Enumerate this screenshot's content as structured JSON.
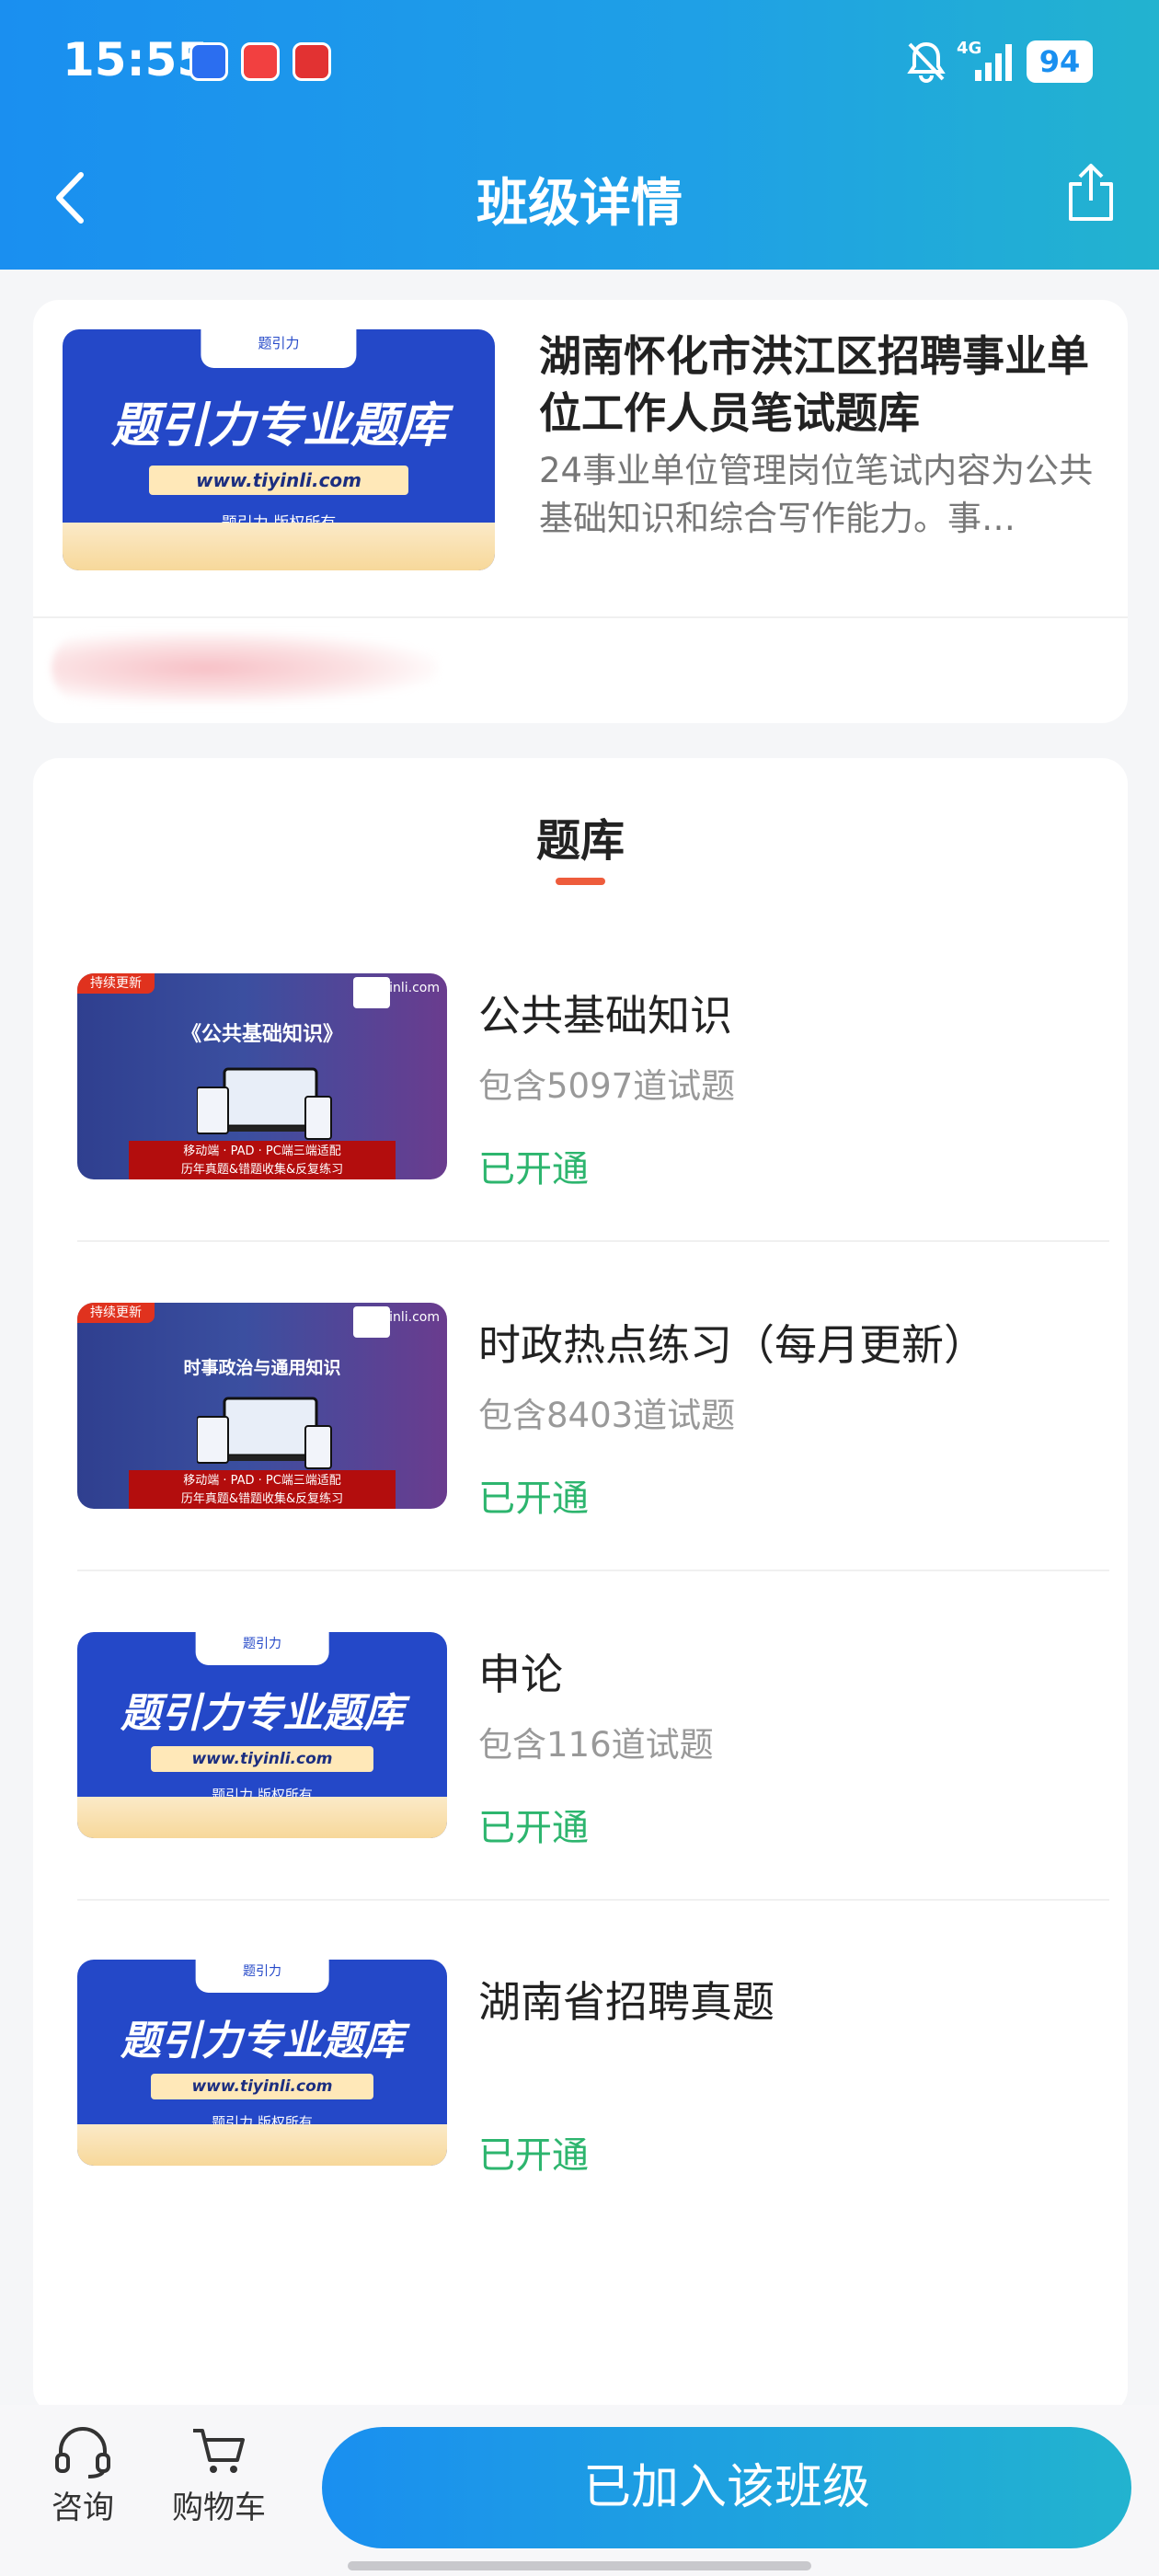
{
  "status_bar": {
    "time": "15:55",
    "network": "4G",
    "battery": "94"
  },
  "header": {
    "title": "班级详情"
  },
  "class_info": {
    "title": "湖南怀化市洪江区招聘事业单位工作人员笔试题库",
    "description": "24事业单位管理岗位笔试内容为公共基础知识和综合写作能力。事…",
    "thumb": {
      "tab": "题引力",
      "headline": "题引力专业题库",
      "url": "www.tiyinli.com",
      "copyright": "题引力 版权所有"
    }
  },
  "section": {
    "title": "题库"
  },
  "banks": [
    {
      "name": "公共基础知识",
      "count": "包含5097道试题",
      "status": "已开通",
      "thumb": {
        "badge": "持续更新",
        "site": "tiyinli.com",
        "headline": "《公共基础知识》",
        "banner1": "移动端 · PAD · PC端三端适配",
        "banner2": "历年真题&错题收集&反复练习"
      }
    },
    {
      "name": "时政热点练习（每月更新）",
      "count": "包含8403道试题",
      "status": "已开通",
      "thumb": {
        "badge": "持续更新",
        "site": "tiyinli.com",
        "headline": "时事政治与通用知识",
        "banner1": "移动端 · PAD · PC端三端适配",
        "banner2": "历年真题&错题收集&反复练习"
      }
    },
    {
      "name": "申论",
      "count": "包含116道试题",
      "status": "已开通",
      "thumb": {
        "tab": "题引力",
        "headline": "题引力专业题库",
        "url": "www.tiyinli.com",
        "copyright": "题引力 版权所有"
      }
    },
    {
      "name": "湖南省招聘真题",
      "count": "",
      "status": "已开通",
      "thumb": {
        "tab": "题引力",
        "headline": "题引力专业题库",
        "url": "www.tiyinli.com",
        "copyright": "题引力 版权所有"
      }
    }
  ],
  "bottom_bar": {
    "consult": "咨询",
    "cart": "购物车",
    "join_button": "已加入该班级"
  },
  "colors": {
    "primary": "#1a8ff0",
    "accent_green": "#2db56e",
    "tab_underline": "#ee5c3c"
  }
}
